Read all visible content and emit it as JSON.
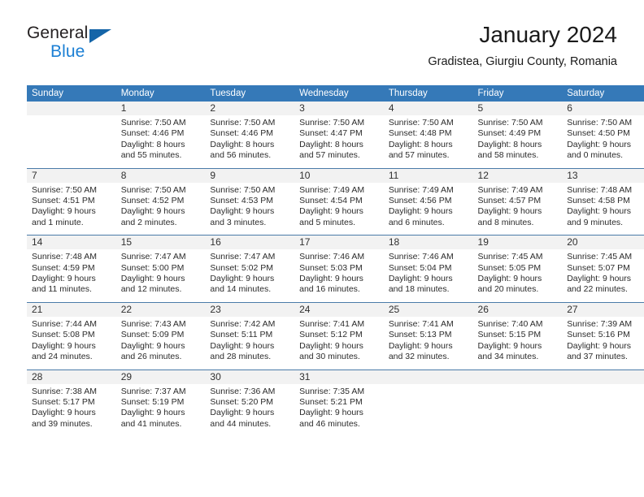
{
  "brand": {
    "name_top": "General",
    "name_bottom": "Blue",
    "triangle_color": "#1565a8",
    "blue_color": "#1b7fd4"
  },
  "header": {
    "title": "January 2024",
    "subtitle": "Gradistea, Giurgiu County, Romania"
  },
  "theme": {
    "header_bar": "#3579b8",
    "daynum_band": "#f2f2f2",
    "row_divider": "#4a7ba8"
  },
  "weekday_headers": [
    "Sunday",
    "Monday",
    "Tuesday",
    "Wednesday",
    "Thursday",
    "Friday",
    "Saturday"
  ],
  "weeks": [
    [
      {
        "day": "",
        "sunrise": "",
        "sunset": "",
        "daylight_line1": "",
        "daylight_line2": ""
      },
      {
        "day": "1",
        "sunrise": "Sunrise: 7:50 AM",
        "sunset": "Sunset: 4:46 PM",
        "daylight_line1": "Daylight: 8 hours",
        "daylight_line2": "and 55 minutes."
      },
      {
        "day": "2",
        "sunrise": "Sunrise: 7:50 AM",
        "sunset": "Sunset: 4:46 PM",
        "daylight_line1": "Daylight: 8 hours",
        "daylight_line2": "and 56 minutes."
      },
      {
        "day": "3",
        "sunrise": "Sunrise: 7:50 AM",
        "sunset": "Sunset: 4:47 PM",
        "daylight_line1": "Daylight: 8 hours",
        "daylight_line2": "and 57 minutes."
      },
      {
        "day": "4",
        "sunrise": "Sunrise: 7:50 AM",
        "sunset": "Sunset: 4:48 PM",
        "daylight_line1": "Daylight: 8 hours",
        "daylight_line2": "and 57 minutes."
      },
      {
        "day": "5",
        "sunrise": "Sunrise: 7:50 AM",
        "sunset": "Sunset: 4:49 PM",
        "daylight_line1": "Daylight: 8 hours",
        "daylight_line2": "and 58 minutes."
      },
      {
        "day": "6",
        "sunrise": "Sunrise: 7:50 AM",
        "sunset": "Sunset: 4:50 PM",
        "daylight_line1": "Daylight: 9 hours",
        "daylight_line2": "and 0 minutes."
      }
    ],
    [
      {
        "day": "7",
        "sunrise": "Sunrise: 7:50 AM",
        "sunset": "Sunset: 4:51 PM",
        "daylight_line1": "Daylight: 9 hours",
        "daylight_line2": "and 1 minute."
      },
      {
        "day": "8",
        "sunrise": "Sunrise: 7:50 AM",
        "sunset": "Sunset: 4:52 PM",
        "daylight_line1": "Daylight: 9 hours",
        "daylight_line2": "and 2 minutes."
      },
      {
        "day": "9",
        "sunrise": "Sunrise: 7:50 AM",
        "sunset": "Sunset: 4:53 PM",
        "daylight_line1": "Daylight: 9 hours",
        "daylight_line2": "and 3 minutes."
      },
      {
        "day": "10",
        "sunrise": "Sunrise: 7:49 AM",
        "sunset": "Sunset: 4:54 PM",
        "daylight_line1": "Daylight: 9 hours",
        "daylight_line2": "and 5 minutes."
      },
      {
        "day": "11",
        "sunrise": "Sunrise: 7:49 AM",
        "sunset": "Sunset: 4:56 PM",
        "daylight_line1": "Daylight: 9 hours",
        "daylight_line2": "and 6 minutes."
      },
      {
        "day": "12",
        "sunrise": "Sunrise: 7:49 AM",
        "sunset": "Sunset: 4:57 PM",
        "daylight_line1": "Daylight: 9 hours",
        "daylight_line2": "and 8 minutes."
      },
      {
        "day": "13",
        "sunrise": "Sunrise: 7:48 AM",
        "sunset": "Sunset: 4:58 PM",
        "daylight_line1": "Daylight: 9 hours",
        "daylight_line2": "and 9 minutes."
      }
    ],
    [
      {
        "day": "14",
        "sunrise": "Sunrise: 7:48 AM",
        "sunset": "Sunset: 4:59 PM",
        "daylight_line1": "Daylight: 9 hours",
        "daylight_line2": "and 11 minutes."
      },
      {
        "day": "15",
        "sunrise": "Sunrise: 7:47 AM",
        "sunset": "Sunset: 5:00 PM",
        "daylight_line1": "Daylight: 9 hours",
        "daylight_line2": "and 12 minutes."
      },
      {
        "day": "16",
        "sunrise": "Sunrise: 7:47 AM",
        "sunset": "Sunset: 5:02 PM",
        "daylight_line1": "Daylight: 9 hours",
        "daylight_line2": "and 14 minutes."
      },
      {
        "day": "17",
        "sunrise": "Sunrise: 7:46 AM",
        "sunset": "Sunset: 5:03 PM",
        "daylight_line1": "Daylight: 9 hours",
        "daylight_line2": "and 16 minutes."
      },
      {
        "day": "18",
        "sunrise": "Sunrise: 7:46 AM",
        "sunset": "Sunset: 5:04 PM",
        "daylight_line1": "Daylight: 9 hours",
        "daylight_line2": "and 18 minutes."
      },
      {
        "day": "19",
        "sunrise": "Sunrise: 7:45 AM",
        "sunset": "Sunset: 5:05 PM",
        "daylight_line1": "Daylight: 9 hours",
        "daylight_line2": "and 20 minutes."
      },
      {
        "day": "20",
        "sunrise": "Sunrise: 7:45 AM",
        "sunset": "Sunset: 5:07 PM",
        "daylight_line1": "Daylight: 9 hours",
        "daylight_line2": "and 22 minutes."
      }
    ],
    [
      {
        "day": "21",
        "sunrise": "Sunrise: 7:44 AM",
        "sunset": "Sunset: 5:08 PM",
        "daylight_line1": "Daylight: 9 hours",
        "daylight_line2": "and 24 minutes."
      },
      {
        "day": "22",
        "sunrise": "Sunrise: 7:43 AM",
        "sunset": "Sunset: 5:09 PM",
        "daylight_line1": "Daylight: 9 hours",
        "daylight_line2": "and 26 minutes."
      },
      {
        "day": "23",
        "sunrise": "Sunrise: 7:42 AM",
        "sunset": "Sunset: 5:11 PM",
        "daylight_line1": "Daylight: 9 hours",
        "daylight_line2": "and 28 minutes."
      },
      {
        "day": "24",
        "sunrise": "Sunrise: 7:41 AM",
        "sunset": "Sunset: 5:12 PM",
        "daylight_line1": "Daylight: 9 hours",
        "daylight_line2": "and 30 minutes."
      },
      {
        "day": "25",
        "sunrise": "Sunrise: 7:41 AM",
        "sunset": "Sunset: 5:13 PM",
        "daylight_line1": "Daylight: 9 hours",
        "daylight_line2": "and 32 minutes."
      },
      {
        "day": "26",
        "sunrise": "Sunrise: 7:40 AM",
        "sunset": "Sunset: 5:15 PM",
        "daylight_line1": "Daylight: 9 hours",
        "daylight_line2": "and 34 minutes."
      },
      {
        "day": "27",
        "sunrise": "Sunrise: 7:39 AM",
        "sunset": "Sunset: 5:16 PM",
        "daylight_line1": "Daylight: 9 hours",
        "daylight_line2": "and 37 minutes."
      }
    ],
    [
      {
        "day": "28",
        "sunrise": "Sunrise: 7:38 AM",
        "sunset": "Sunset: 5:17 PM",
        "daylight_line1": "Daylight: 9 hours",
        "daylight_line2": "and 39 minutes."
      },
      {
        "day": "29",
        "sunrise": "Sunrise: 7:37 AM",
        "sunset": "Sunset: 5:19 PM",
        "daylight_line1": "Daylight: 9 hours",
        "daylight_line2": "and 41 minutes."
      },
      {
        "day": "30",
        "sunrise": "Sunrise: 7:36 AM",
        "sunset": "Sunset: 5:20 PM",
        "daylight_line1": "Daylight: 9 hours",
        "daylight_line2": "and 44 minutes."
      },
      {
        "day": "31",
        "sunrise": "Sunrise: 7:35 AM",
        "sunset": "Sunset: 5:21 PM",
        "daylight_line1": "Daylight: 9 hours",
        "daylight_line2": "and 46 minutes."
      },
      {
        "day": "",
        "sunrise": "",
        "sunset": "",
        "daylight_line1": "",
        "daylight_line2": ""
      },
      {
        "day": "",
        "sunrise": "",
        "sunset": "",
        "daylight_line1": "",
        "daylight_line2": ""
      },
      {
        "day": "",
        "sunrise": "",
        "sunset": "",
        "daylight_line1": "",
        "daylight_line2": ""
      }
    ]
  ]
}
